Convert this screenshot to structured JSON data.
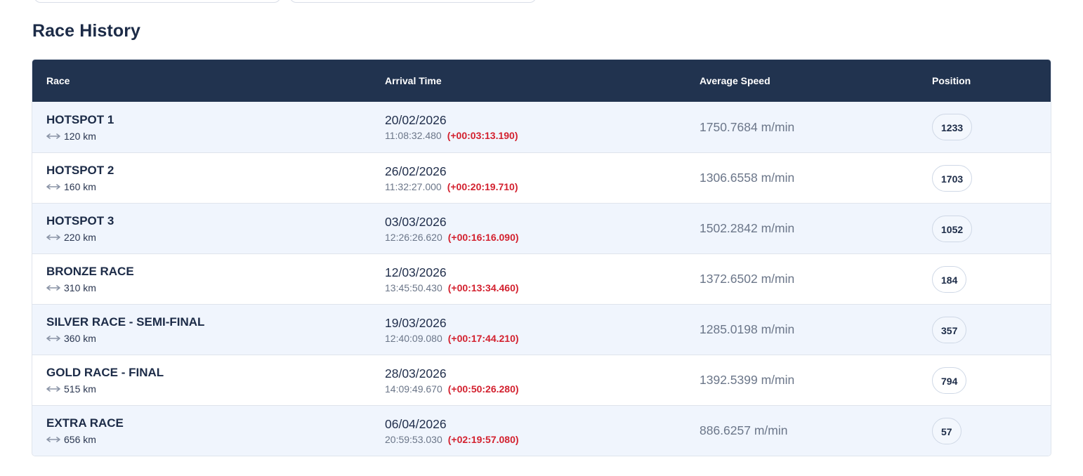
{
  "section": {
    "title": "Race History"
  },
  "table": {
    "headers": {
      "race": "Race",
      "arrival": "Arrival Time",
      "speed": "Average Speed",
      "position": "Position"
    },
    "rows": [
      {
        "race": "HOTSPOT 1",
        "distance": "120 km",
        "date": "20/02/2026",
        "time": "11:08:32.480",
        "delta": "(+00:03:13.190)",
        "speed": "1750.7684 m/min",
        "position": "1233"
      },
      {
        "race": "HOTSPOT 2",
        "distance": "160 km",
        "date": "26/02/2026",
        "time": "11:32:27.000",
        "delta": "(+00:20:19.710)",
        "speed": "1306.6558 m/min",
        "position": "1703"
      },
      {
        "race": "HOTSPOT 3",
        "distance": "220 km",
        "date": "03/03/2026",
        "time": "12:26:26.620",
        "delta": "(+00:16:16.090)",
        "speed": "1502.2842 m/min",
        "position": "1052"
      },
      {
        "race": "BRONZE RACE",
        "distance": "310 km",
        "date": "12/03/2026",
        "time": "13:45:50.430",
        "delta": "(+00:13:34.460)",
        "speed": "1372.6502 m/min",
        "position": "184"
      },
      {
        "race": "SILVER RACE - SEMI-FINAL",
        "distance": "360 km",
        "date": "19/03/2026",
        "time": "12:40:09.080",
        "delta": "(+00:17:44.210)",
        "speed": "1285.0198 m/min",
        "position": "357"
      },
      {
        "race": "GOLD RACE - FINAL",
        "distance": "515 km",
        "date": "28/03/2026",
        "time": "14:09:49.670",
        "delta": "(+00:50:26.280)",
        "speed": "1392.5399 m/min",
        "position": "794"
      },
      {
        "race": "EXTRA RACE",
        "distance": "656 km",
        "date": "06/04/2026",
        "time": "20:59:53.030",
        "delta": "(+02:19:57.080)",
        "speed": "886.6257 m/min",
        "position": "57"
      }
    ]
  },
  "colors": {
    "header_bg": "#21334f",
    "delta": "#d3212f",
    "alt_row": "#f0f5fd"
  },
  "icons": {
    "distance": "arrow-left-right-icon"
  }
}
